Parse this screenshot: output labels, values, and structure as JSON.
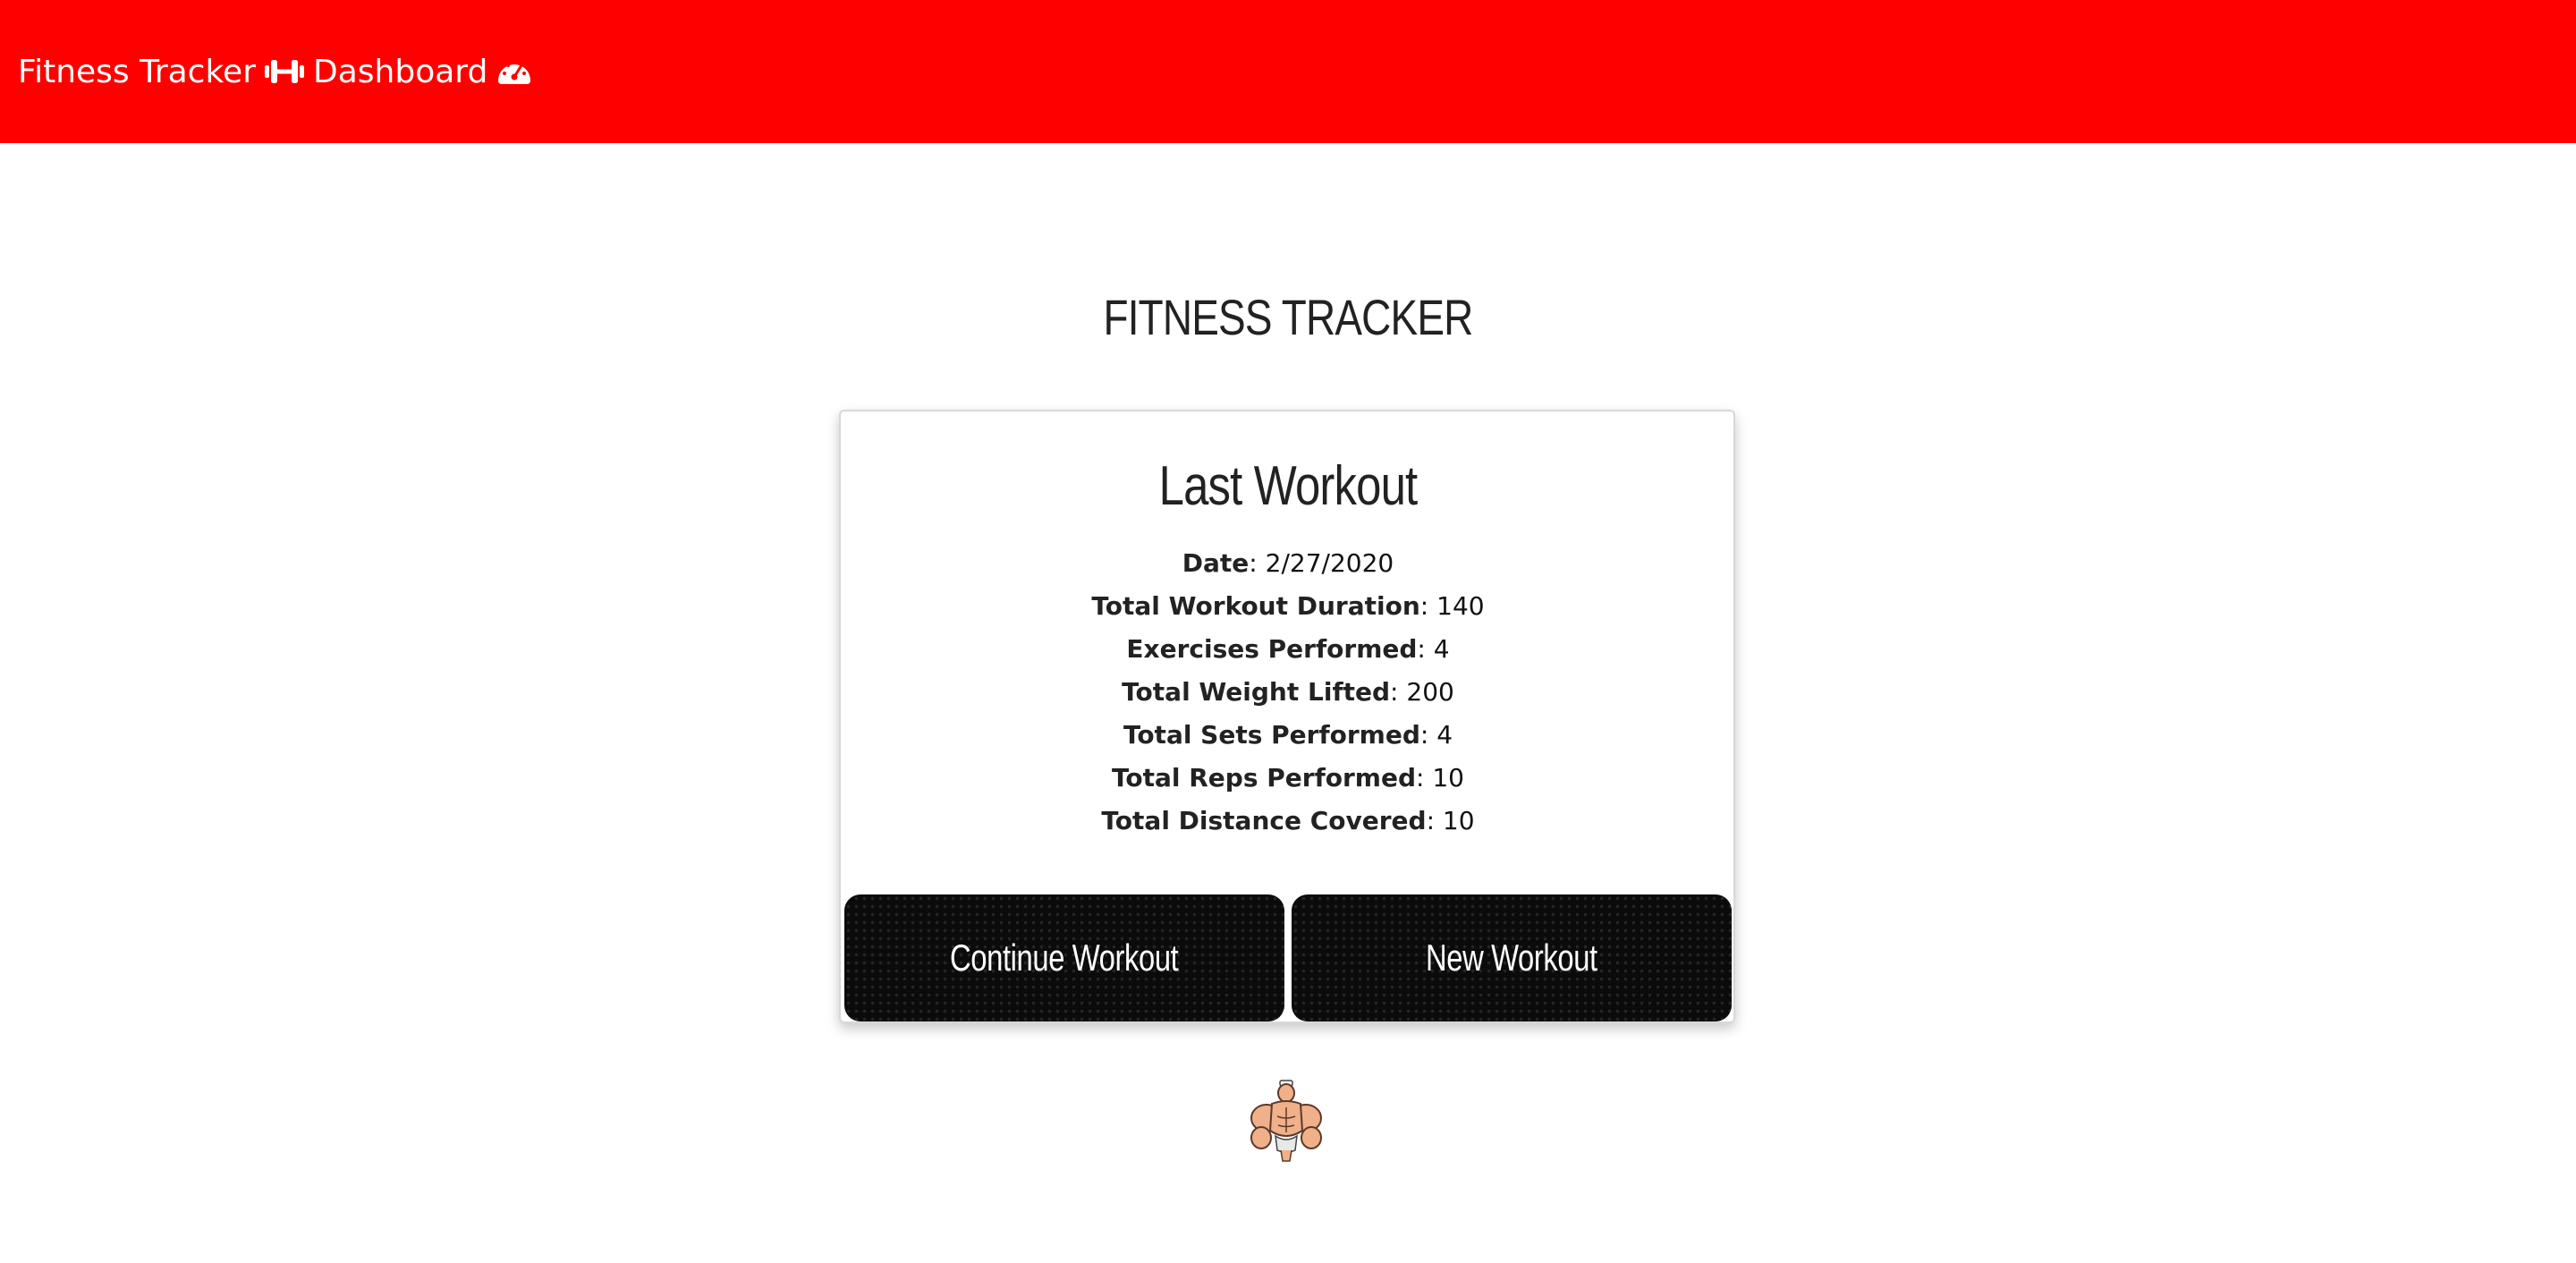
{
  "navbar": {
    "brand_text": "Fitness Tracker",
    "brand_icon": "dumbbell-icon",
    "dashboard_text": "Dashboard",
    "dashboard_icon": "tachometer-icon",
    "background_color": "#ff0000",
    "text_color": "#ffffff"
  },
  "page": {
    "title": "FITNESS TRACKER"
  },
  "last_workout": {
    "title": "Last Workout",
    "stats": [
      {
        "label": "Date",
        "value": ": 2/27/2020"
      },
      {
        "label": "Total Workout Duration",
        "value": ": 140"
      },
      {
        "label": "Exercises Performed",
        "value": ": 4"
      },
      {
        "label": "Total Weight Lifted",
        "value": ": 200"
      },
      {
        "label": "Total Sets Performed",
        "value": ": 4"
      },
      {
        "label": "Total Reps Performed",
        "value": ": 10"
      },
      {
        "label": "Total Distance Covered",
        "value": ": 10"
      }
    ]
  },
  "actions": {
    "continue_label": "Continue Workout",
    "new_label": "New Workout",
    "button_color": "#0b0b0b"
  },
  "footer": {
    "mascot_icon": "muscle-man-icon"
  }
}
